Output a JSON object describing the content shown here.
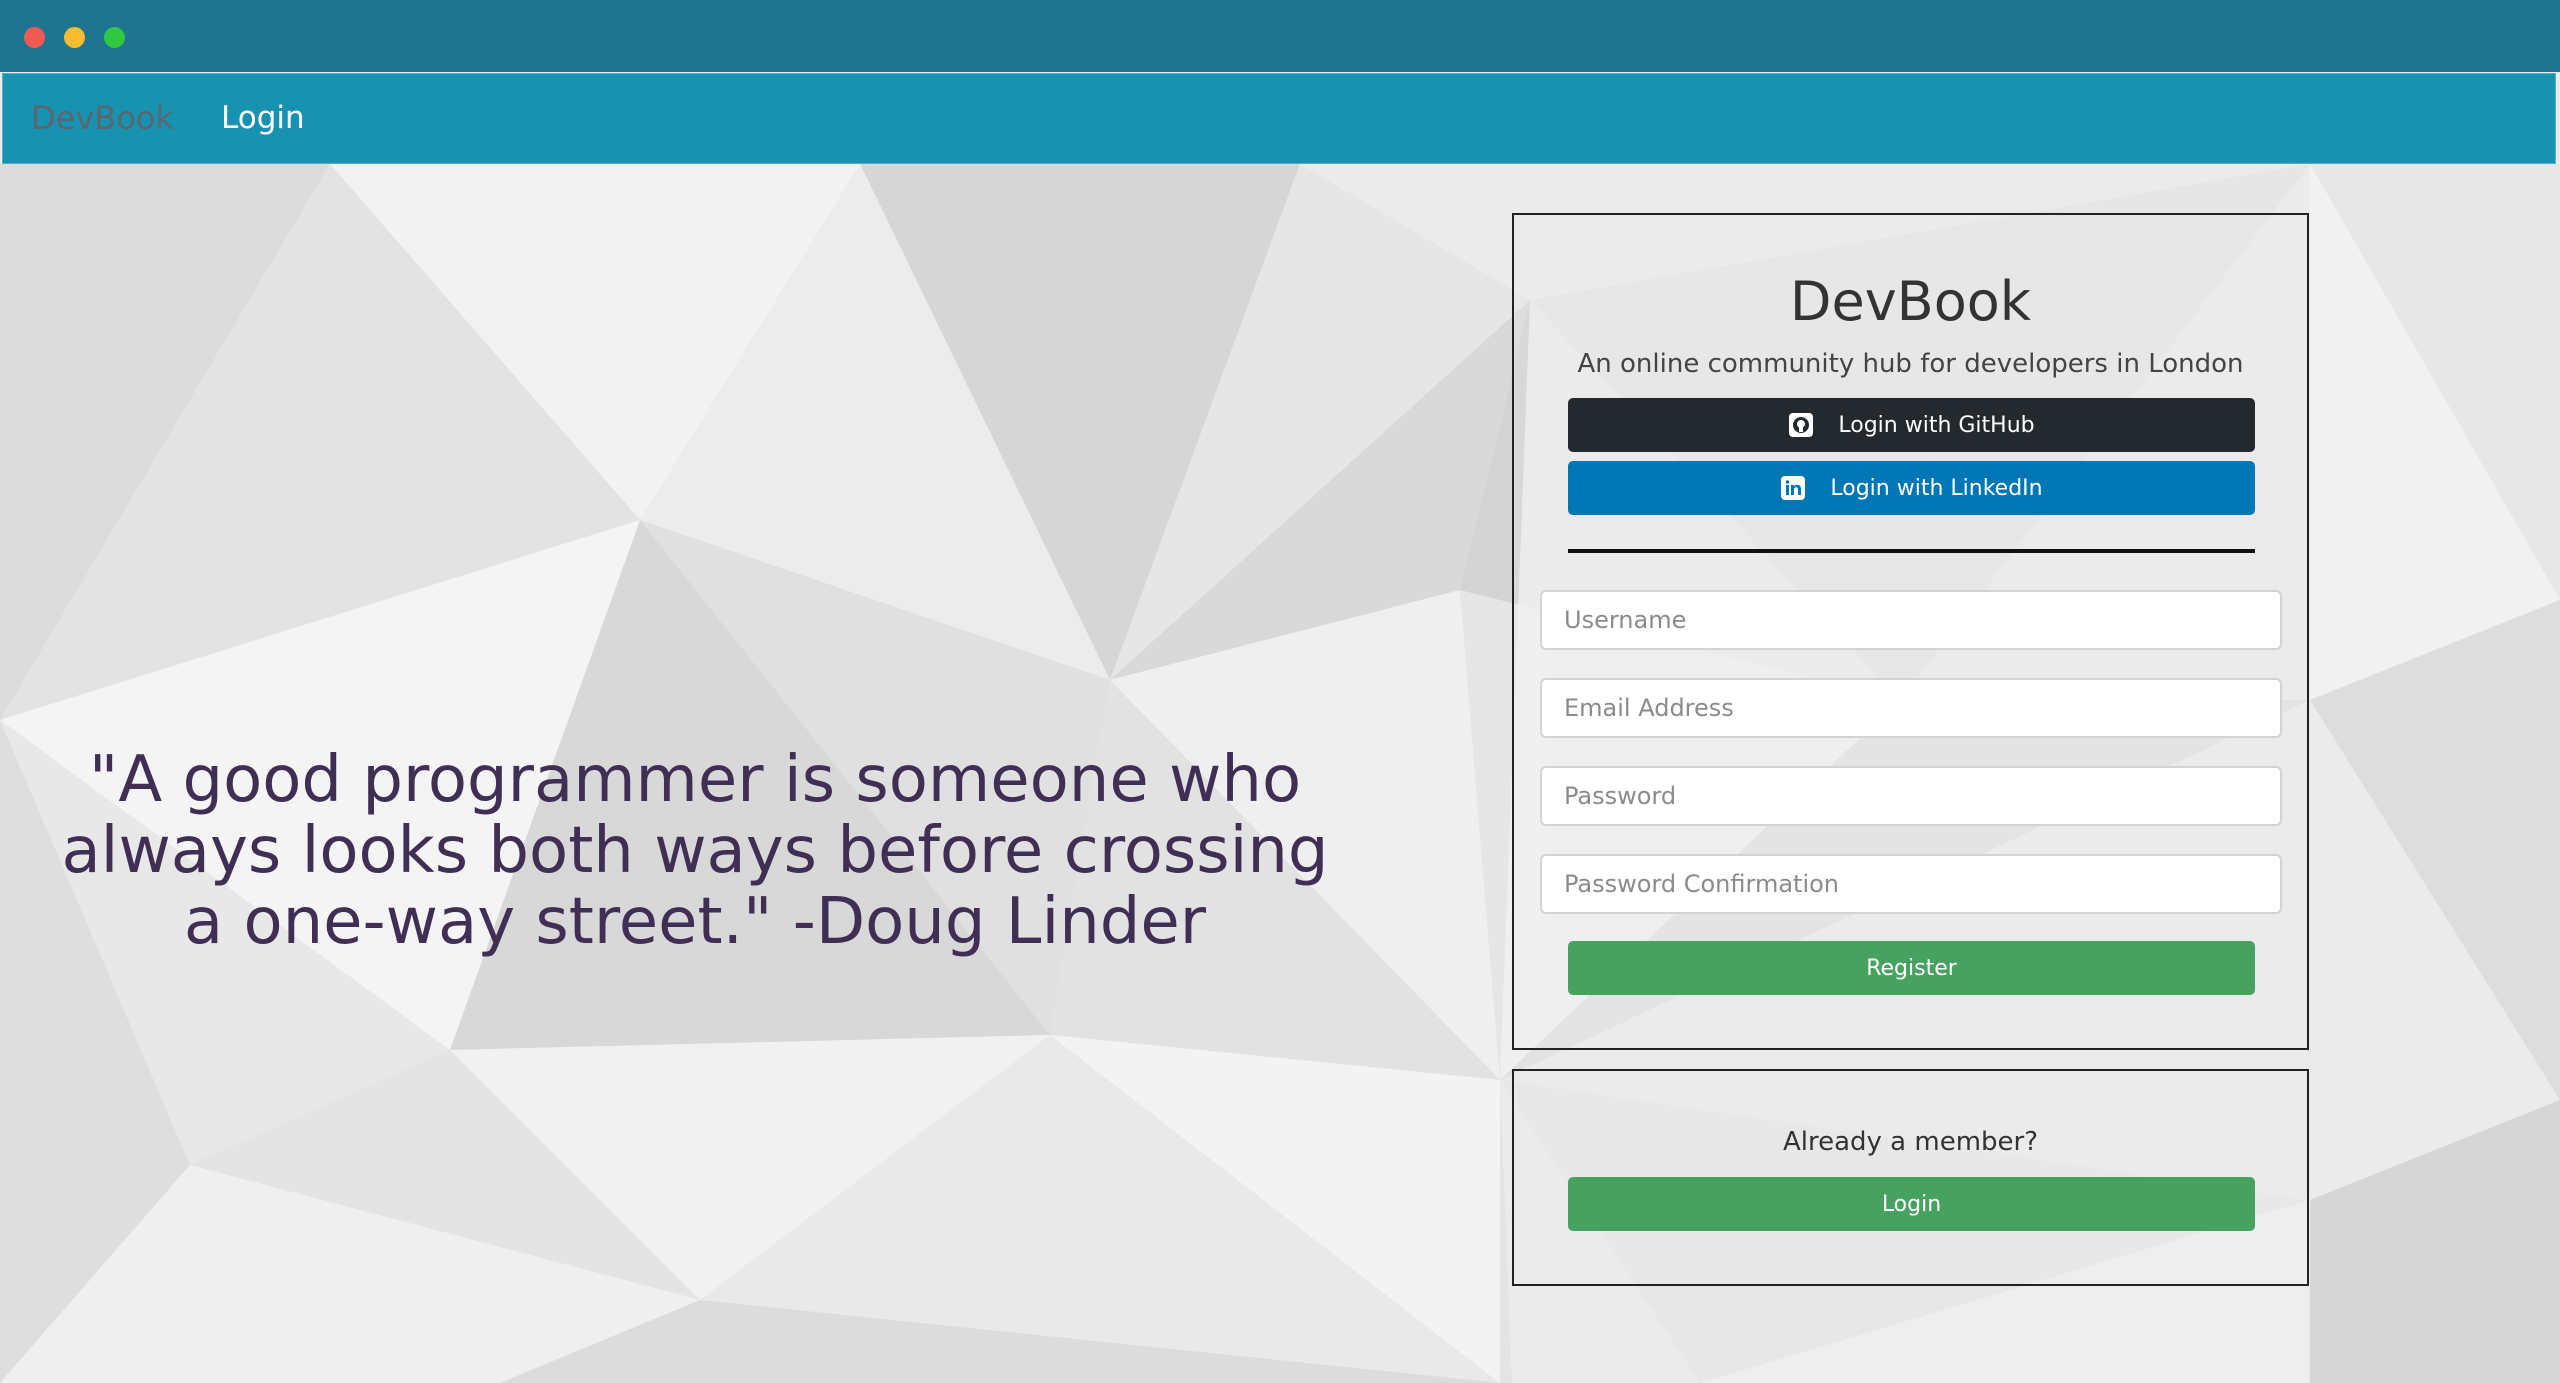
{
  "window": {
    "traffic_lights": {
      "close": "#ee5a52",
      "minimize": "#f5bd2f",
      "maximize": "#2fc840"
    }
  },
  "navbar": {
    "brand": "DevBook",
    "login_link": "Login"
  },
  "quote": {
    "text": "\"A good programmer is someone who always looks both ways before crossing a one-way street.\" -Doug Linder"
  },
  "signup_card": {
    "title": "DevBook",
    "subtitle": "An online community hub for developers in London",
    "github_button": "Login with GitHub",
    "linkedin_button": "Login with LinkedIn",
    "fields": {
      "username_placeholder": "Username",
      "email_placeholder": "Email Address",
      "password_placeholder": "Password",
      "password_confirmation_placeholder": "Password Confirmation"
    },
    "register_button": "Register"
  },
  "login_card": {
    "prompt": "Already a member?",
    "login_button": "Login"
  },
  "colors": {
    "titlebar": "#1f7590",
    "navbar": "#1892b1",
    "github": "#24292e",
    "linkedin": "#0077b5",
    "success": "#47a25f",
    "quote_text": "#3f2f55"
  }
}
